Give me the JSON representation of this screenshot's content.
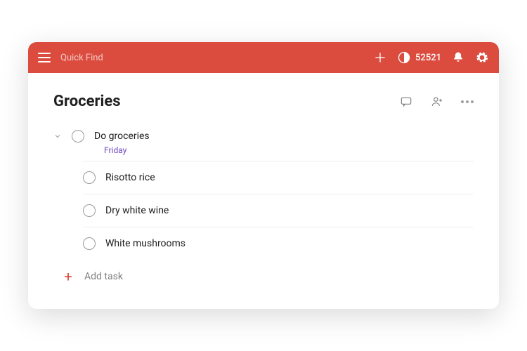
{
  "topbar": {
    "search_placeholder": "Quick Find",
    "karma_count": "52521"
  },
  "page": {
    "title": "Groceries"
  },
  "parent_task": {
    "title": "Do groceries",
    "due": "Friday"
  },
  "subtasks": [
    {
      "title": "Risotto rice"
    },
    {
      "title": "Dry white wine"
    },
    {
      "title": "White mushrooms"
    }
  ],
  "add_task_label": "Add task"
}
